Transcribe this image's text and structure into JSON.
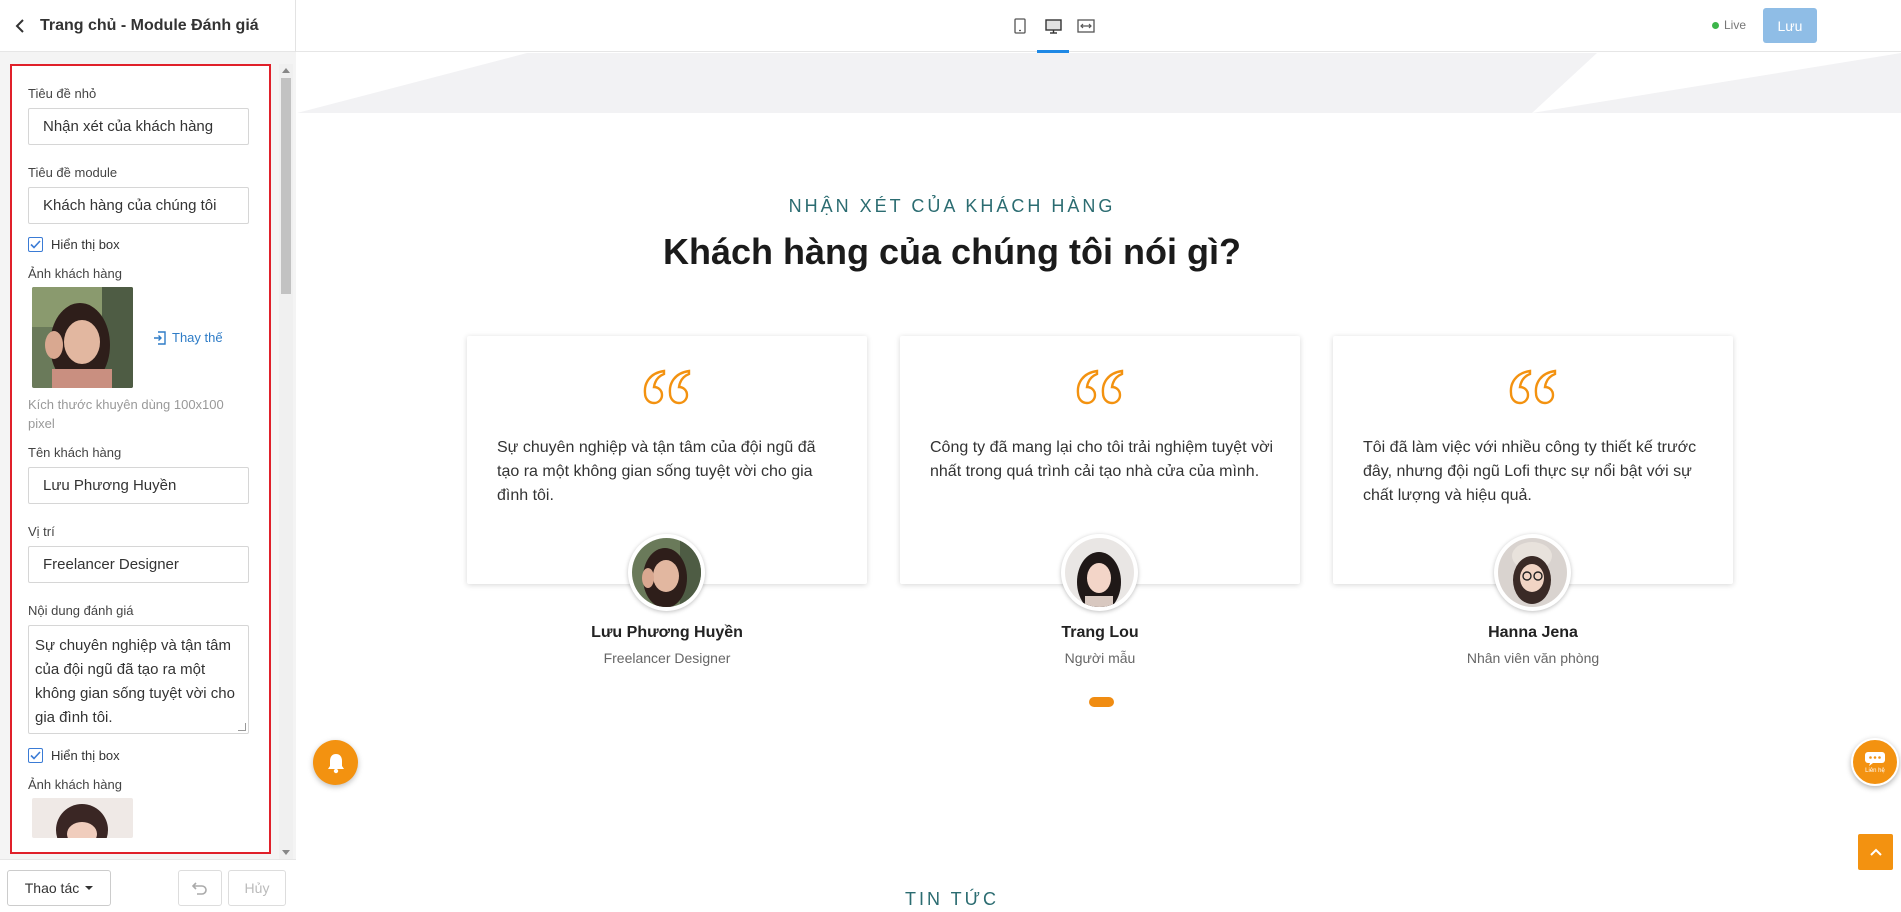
{
  "panel": {
    "title": "Trang chủ - Module Đánh giá",
    "fields": {
      "small_title_label": "Tiêu đề nhỏ",
      "small_title_value": "Nhận xét của khách hàng",
      "module_title_label": "Tiêu đề module",
      "module_title_value": "Khách hàng của chúng tôi",
      "show_box_label": "Hiển thị box",
      "customer_image_label": "Ảnh khách hàng",
      "replace_label": "Thay thế",
      "size_hint": "Kích thước khuyên dùng 100x100 pixel",
      "customer_name_label": "Tên khách hàng",
      "customer_name_value": "Lưu Phương Huyền",
      "position_label": "Vị trí",
      "position_value": "Freelancer Designer",
      "review_label": "Nội dung đánh giá",
      "review_value": "Sự chuyên nghiệp và tận tâm của đội ngũ đã tạo ra một không gian sống tuyệt vời cho gia đình tôi.",
      "show_box_label_2": "Hiển thị box",
      "customer_image_label_2": "Ảnh khách hàng"
    },
    "footer": {
      "action_label": "Thao tác",
      "cancel_label": "Hủy"
    }
  },
  "toolbar": {
    "live_label": "Live",
    "save_label": "Lưu",
    "devices": [
      "mobile-icon",
      "desktop-icon",
      "fullwidth-icon"
    ],
    "active_device": "desktop-icon"
  },
  "preview": {
    "subtitle": "NHẬN XÉT CỦA KHÁCH HÀNG",
    "heading": "Khách hàng của chúng tôi nói gì?",
    "testimonials": [
      {
        "text": "Sự chuyên nghiệp và tận tâm của đội ngũ đã tạo ra một không gian sống tuyệt vời cho gia đình tôi.",
        "name": "Lưu Phương Huyền",
        "role": "Freelancer Designer"
      },
      {
        "text": "Công ty đã mang lại cho tôi trải nghiệm tuyệt vời nhất trong quá trình cải tạo nhà cửa của mình.",
        "name": "Trang Lou",
        "role": "Người mẫu"
      },
      {
        "text": "Tôi đã làm việc với nhiều công ty thiết kế trước đây, nhưng đội ngũ Lofi thực sự nổi bật với sự chất lượng và hiệu quả.",
        "name": "Hanna Jena",
        "role": "Nhân viên văn phòng"
      }
    ],
    "news_title": "TIN TỨC",
    "chat_label": "Liên hệ"
  },
  "colors": {
    "accent": "#f39210",
    "teal": "#2b6c71",
    "primary_blue": "#1e88e5",
    "highlight_border": "#e0202a"
  }
}
